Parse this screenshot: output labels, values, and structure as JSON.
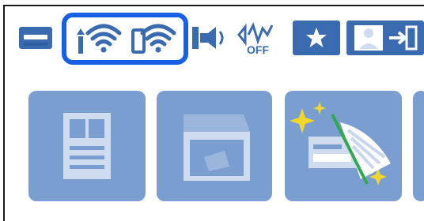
{
  "statusbar": {
    "icons": [
      {
        "name": "printer-status-icon",
        "color": "#3a6ab0"
      },
      {
        "name": "wifi-signal-icon",
        "color": "#3a6ab0"
      },
      {
        "name": "wifi-direct-icon",
        "color": "#3a6ab0"
      },
      {
        "name": "sound-icon",
        "color": "#3a6ab0"
      },
      {
        "name": "quiet-mode-off-icon",
        "label": "OFF",
        "color": "#3a6ab0"
      },
      {
        "name": "favorites-star-icon",
        "color": "#3a6ab0"
      },
      {
        "name": "user-login-icon",
        "color": "#3a6ab0"
      }
    ],
    "highlight_color": "#1760e6"
  },
  "tiles": [
    {
      "name": "copy-tile",
      "icon": "document-icon"
    },
    {
      "name": "scan-tile",
      "icon": "scanner-box-icon"
    },
    {
      "name": "scan-copy-tile",
      "icon": "sparkle-scan-icon"
    },
    {
      "name": "next-tile",
      "icon": "partial-tile"
    }
  ],
  "colors": {
    "tile_bg": "#7b9ed1",
    "tile_icon_fg": "#cfdcf0",
    "button_bg": "#3a6ab0",
    "accent_yellow": "#f1d72a",
    "accent_green": "#2fa84f"
  }
}
